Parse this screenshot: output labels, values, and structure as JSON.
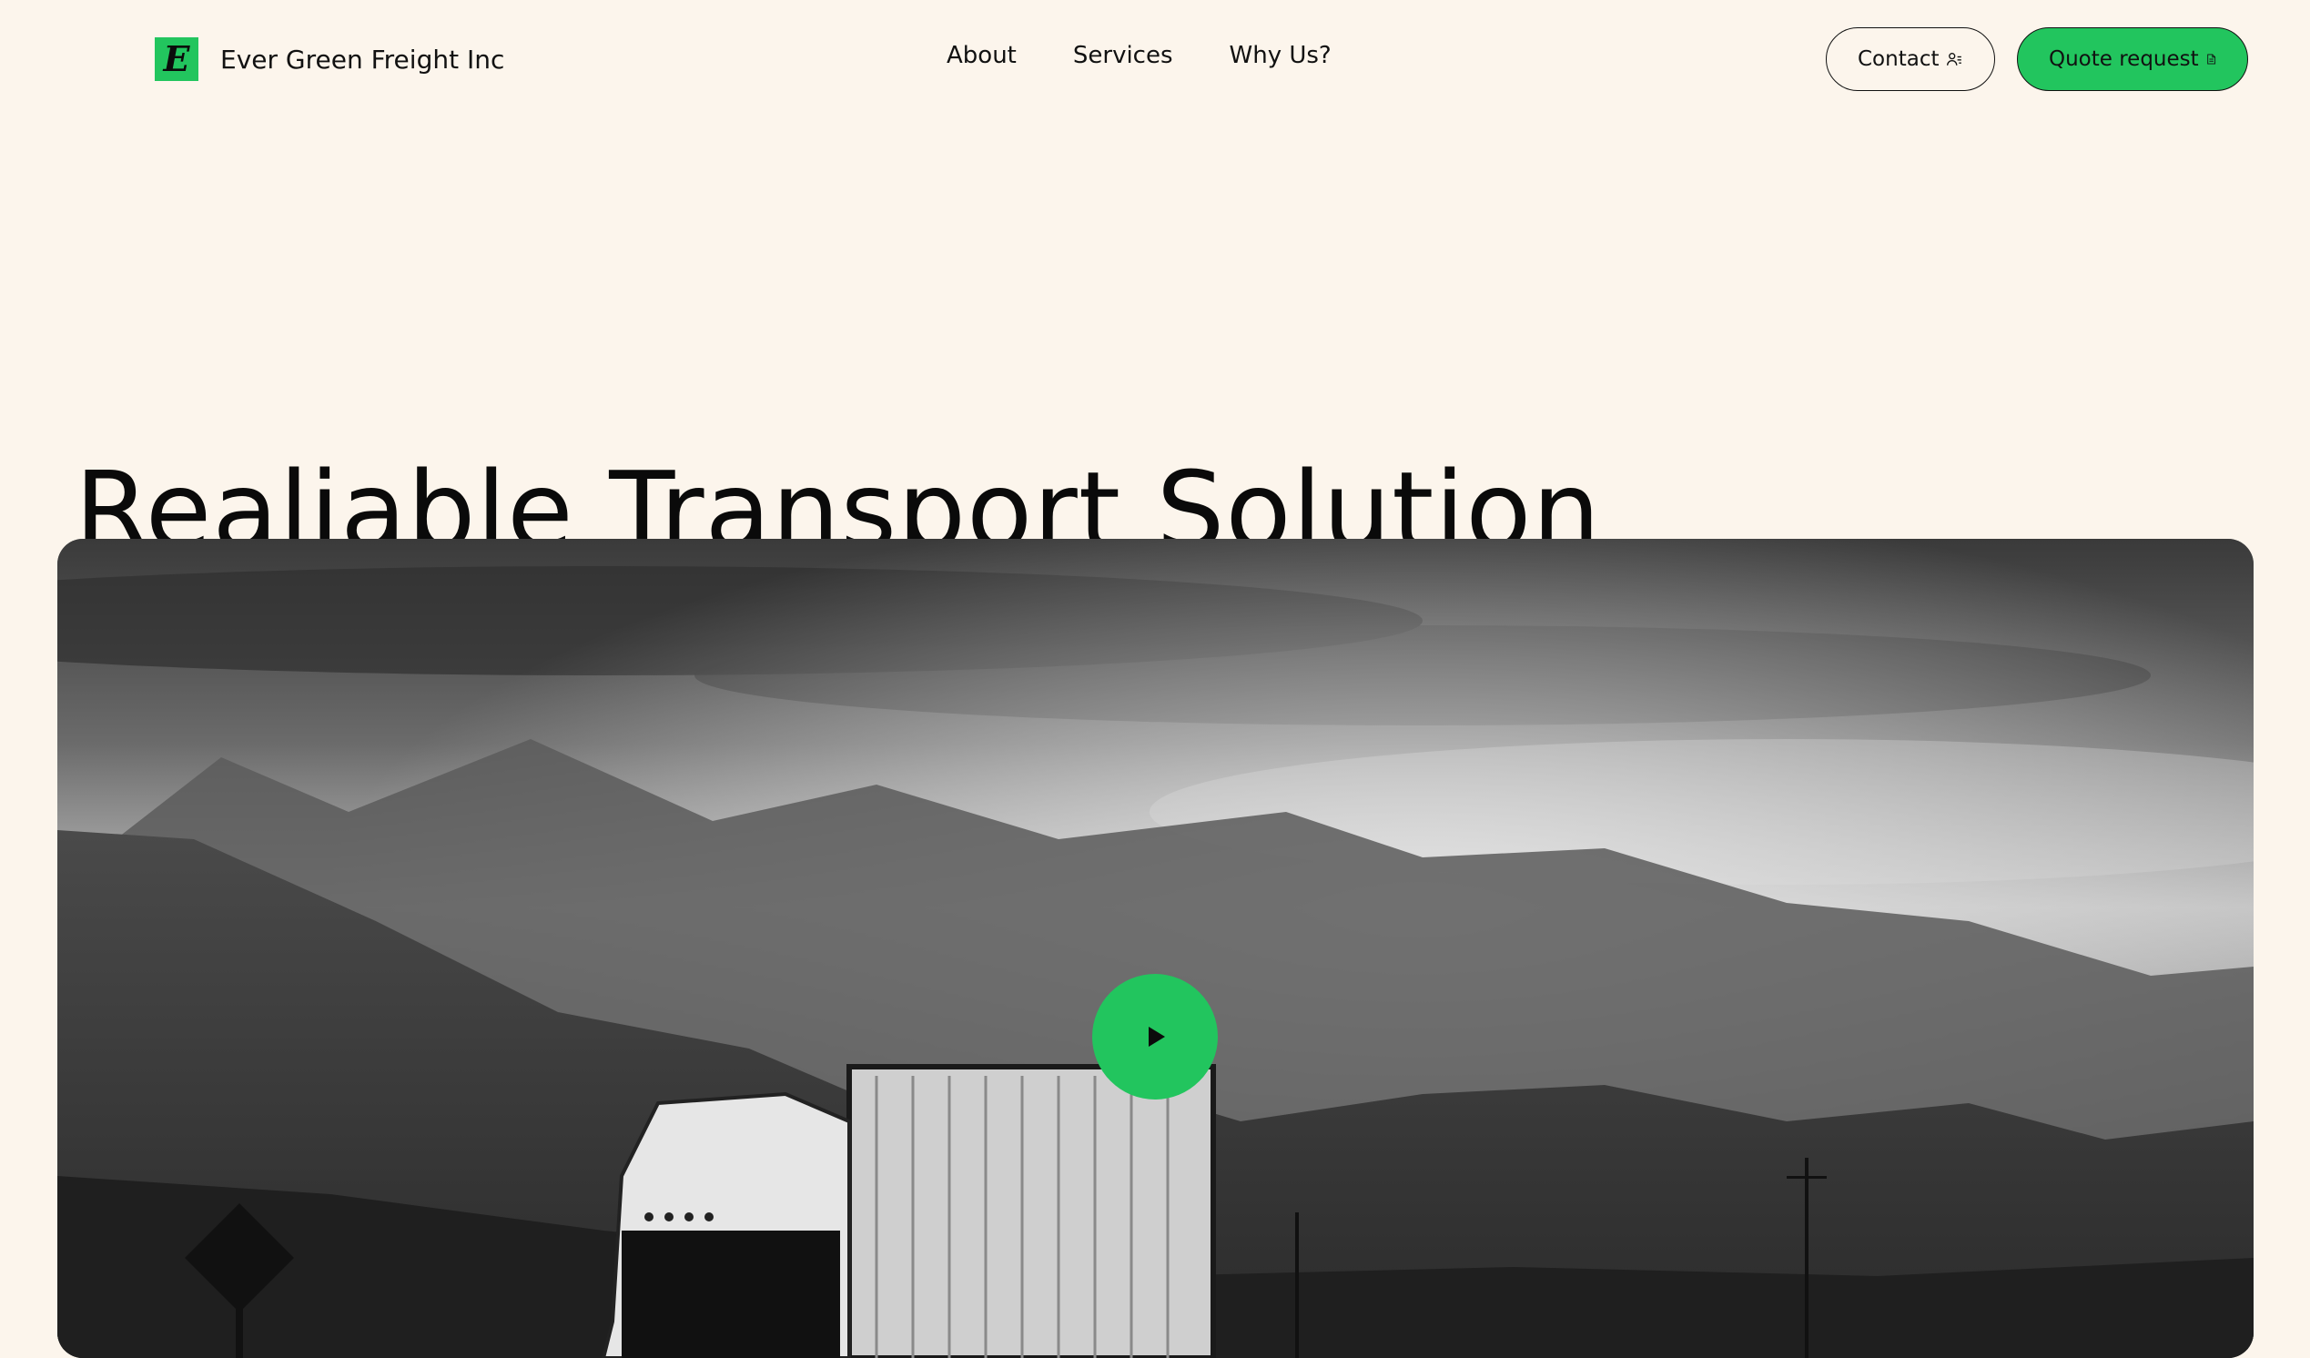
{
  "brand": {
    "logo_letter": "E",
    "name": "Ever Green Freight Inc",
    "accent_color": "#22C55E"
  },
  "nav": {
    "items": [
      {
        "label": "About"
      },
      {
        "label": "Services"
      },
      {
        "label": "Why Us?"
      }
    ]
  },
  "actions": {
    "contact_label": "Contact",
    "contact_icon": "contact-list-icon",
    "quote_label": "Quote request",
    "quote_icon": "document-icon"
  },
  "hero": {
    "title": "Realiable Transport Solution",
    "media_description_icon": "play-icon"
  },
  "colors": {
    "background": "#FCF5EC",
    "accent": "#22C55E",
    "text": "#111111"
  }
}
